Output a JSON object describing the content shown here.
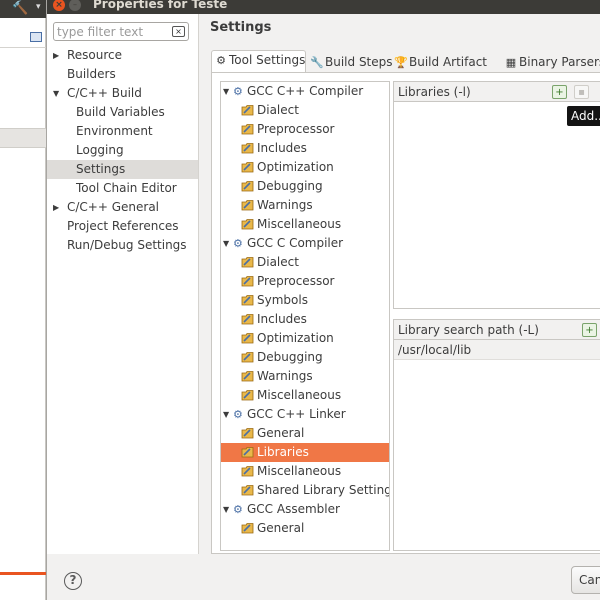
{
  "window": {
    "title": "Properties for Teste"
  },
  "filter": {
    "placeholder": "type filter text"
  },
  "nav": {
    "items": [
      {
        "label": "Resource",
        "level": 0,
        "arrow": "right"
      },
      {
        "label": "Builders",
        "level": 0,
        "arrow": ""
      },
      {
        "label": "C/C++ Build",
        "level": 0,
        "arrow": "down"
      },
      {
        "label": "Build Variables",
        "level": 1,
        "arrow": ""
      },
      {
        "label": "Environment",
        "level": 1,
        "arrow": ""
      },
      {
        "label": "Logging",
        "level": 1,
        "arrow": ""
      },
      {
        "label": "Settings",
        "level": 1,
        "arrow": "",
        "selected": true
      },
      {
        "label": "Tool Chain Editor",
        "level": 1,
        "arrow": ""
      },
      {
        "label": "C/C++ General",
        "level": 0,
        "arrow": "right"
      },
      {
        "label": "Project References",
        "level": 0,
        "arrow": ""
      },
      {
        "label": "Run/Debug Settings",
        "level": 0,
        "arrow": ""
      }
    ]
  },
  "settings": {
    "title": "Settings"
  },
  "tabs": [
    {
      "label": "Tool Settings",
      "icon": "tool-settings-icon",
      "active": true
    },
    {
      "label": "Build Steps",
      "icon": "build-steps-icon"
    },
    {
      "label": "Build Artifact",
      "icon": "build-artifact-icon"
    },
    {
      "label": "Binary Parsers",
      "icon": "binary-parsers-icon"
    }
  ],
  "tool_tree": [
    {
      "label": "GCC C++ Compiler",
      "type": "group"
    },
    {
      "label": "Dialect",
      "type": "child"
    },
    {
      "label": "Preprocessor",
      "type": "child"
    },
    {
      "label": "Includes",
      "type": "child"
    },
    {
      "label": "Optimization",
      "type": "child"
    },
    {
      "label": "Debugging",
      "type": "child"
    },
    {
      "label": "Warnings",
      "type": "child"
    },
    {
      "label": "Miscellaneous",
      "type": "child"
    },
    {
      "label": "GCC C Compiler",
      "type": "group"
    },
    {
      "label": "Dialect",
      "type": "child"
    },
    {
      "label": "Preprocessor",
      "type": "child"
    },
    {
      "label": "Symbols",
      "type": "child"
    },
    {
      "label": "Includes",
      "type": "child"
    },
    {
      "label": "Optimization",
      "type": "child"
    },
    {
      "label": "Debugging",
      "type": "child"
    },
    {
      "label": "Warnings",
      "type": "child"
    },
    {
      "label": "Miscellaneous",
      "type": "child"
    },
    {
      "label": "GCC C++ Linker",
      "type": "group"
    },
    {
      "label": "General",
      "type": "child"
    },
    {
      "label": "Libraries",
      "type": "child",
      "selected": true
    },
    {
      "label": "Miscellaneous",
      "type": "child"
    },
    {
      "label": "Shared Library Settings",
      "type": "child"
    },
    {
      "label": "GCC Assembler",
      "type": "group"
    },
    {
      "label": "General",
      "type": "child"
    }
  ],
  "libraries_pane": {
    "header": "Libraries (-l)",
    "rows": []
  },
  "search_path_pane": {
    "header": "Library search path (-L)",
    "rows": [
      "/usr/local/lib"
    ]
  },
  "tooltip": {
    "text": "Add..."
  },
  "footer": {
    "help": "?",
    "cancel": "Cancel"
  },
  "colors": {
    "selection": "#f07746",
    "titlebar": "#3c3b37",
    "close": "#e95420"
  }
}
